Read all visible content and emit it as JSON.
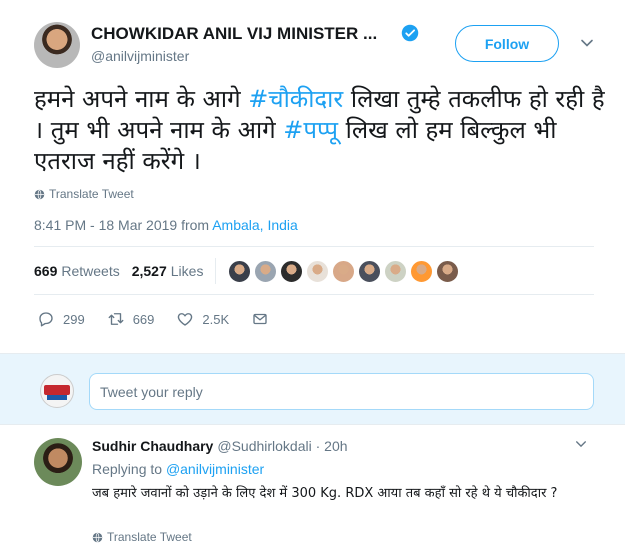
{
  "tweet": {
    "display_name": "CHOWKIDAR ANIL VIJ MINISTER ...",
    "handle": "@anilvijminister",
    "follow_label": "Follow",
    "text_parts": {
      "p1": "हमने अपने नाम के आगे ",
      "h1": "#चौकीदार",
      "p2": " लिखा तुम्हे तकलीफ हो रही है । तुम भी अपने नाम के आगे ",
      "h2": "#पप्पू",
      "p3": " लिख लो हम बिल्कुल भी एतराज नहीं करेंगे ।"
    },
    "translate_label": "Translate Tweet",
    "time": "8:41 PM - 18 Mar 2019 from ",
    "location": "Ambala, India",
    "retweets_count": "669",
    "retweets_label": "Retweets",
    "likes_count": "2,527",
    "likes_label": "Likes",
    "likers": [
      "#3a3f4a",
      "#9aa5b1",
      "#2c2c2c",
      "#e8e1d9",
      "#d8a888",
      "#4a4f5c",
      "#cdd2c4",
      "#ff9933",
      "#7a5c4b"
    ],
    "actions": {
      "replies": "299",
      "retweets": "669",
      "likes": "2.5K"
    }
  },
  "reply_box": {
    "placeholder": "Tweet your reply"
  },
  "reply": {
    "name": "Sudhir Chaudhary",
    "handle_time": "@Sudhirlokdali · 20h",
    "replying_prefix": "Replying to ",
    "replying_handle": "@anilvijminister",
    "text": "जब हमारे जवानों को उड़ाने के लिए देश में 300 Kg. RDX आया तब कहाँ सो रहे थे ये चौकीदार ?",
    "translate_label": "Translate Tweet"
  },
  "colors": {
    "accent": "#1da1f2",
    "muted": "#657786",
    "reply_bg": "#e8f5fd"
  }
}
